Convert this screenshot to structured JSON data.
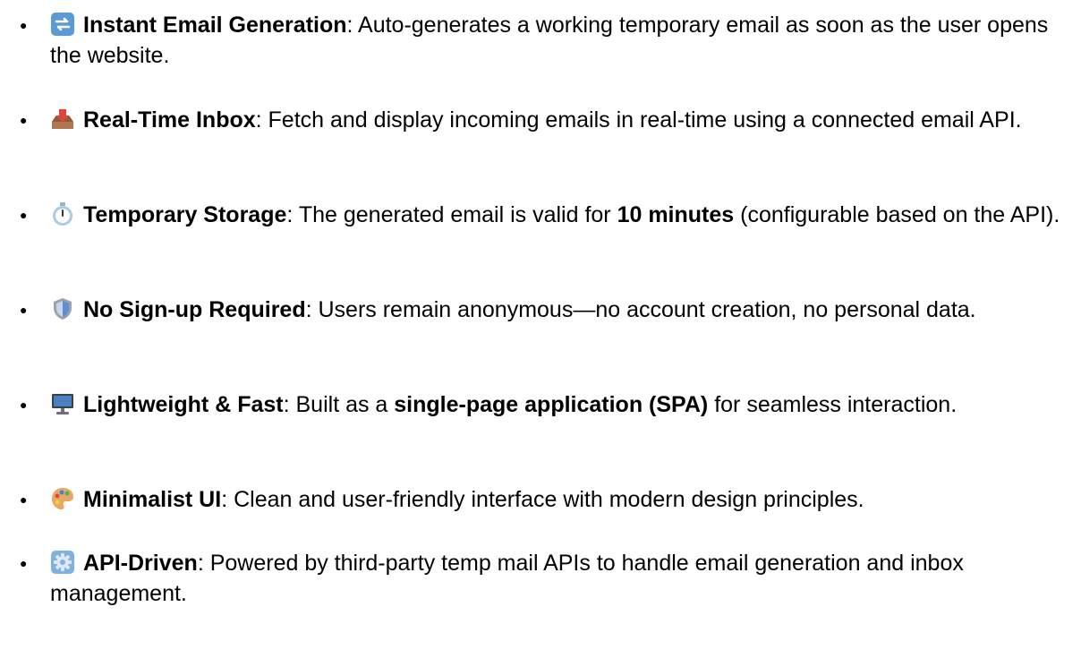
{
  "features": [
    {
      "icon": "refresh-arrows-icon",
      "title": "Instant Email Generation",
      "desc_parts": [
        {
          "text": ": Auto-generates a working temporary email as soon as the user opens the website.",
          "bold": false
        }
      ]
    },
    {
      "icon": "inbox-tray-icon",
      "title": "Real-Time Inbox",
      "desc_parts": [
        {
          "text": ": Fetch and display incoming emails in real-time using a connected email API.",
          "bold": false
        }
      ]
    },
    {
      "icon": "stopwatch-icon",
      "title": "Temporary Storage",
      "desc_parts": [
        {
          "text": ": The generated email is valid for ",
          "bold": false
        },
        {
          "text": "10 minutes",
          "bold": true
        },
        {
          "text": " (configurable based on the API).",
          "bold": false
        }
      ]
    },
    {
      "icon": "shield-icon",
      "title": "No Sign-up Required",
      "desc_parts": [
        {
          "text": ": Users remain anonymous—no account creation, no personal data.",
          "bold": false
        }
      ]
    },
    {
      "icon": "desktop-computer-icon",
      "title": "Lightweight & Fast",
      "desc_parts": [
        {
          "text": ": Built as a ",
          "bold": false
        },
        {
          "text": "single-page application (SPA)",
          "bold": true
        },
        {
          "text": " for seamless interaction.",
          "bold": false
        }
      ]
    },
    {
      "icon": "artist-palette-icon",
      "title": "Minimalist UI",
      "desc_parts": [
        {
          "text": ": Clean and user-friendly interface with modern design principles.",
          "bold": false
        }
      ]
    },
    {
      "icon": "gear-icon",
      "title": "API-Driven",
      "desc_parts": [
        {
          "text": ": Powered by third-party temp mail APIs to handle email generation and inbox management.",
          "bold": false
        }
      ]
    }
  ],
  "bullet_char": "●",
  "colors": {
    "text": "#000000",
    "background": "#ffffff"
  }
}
